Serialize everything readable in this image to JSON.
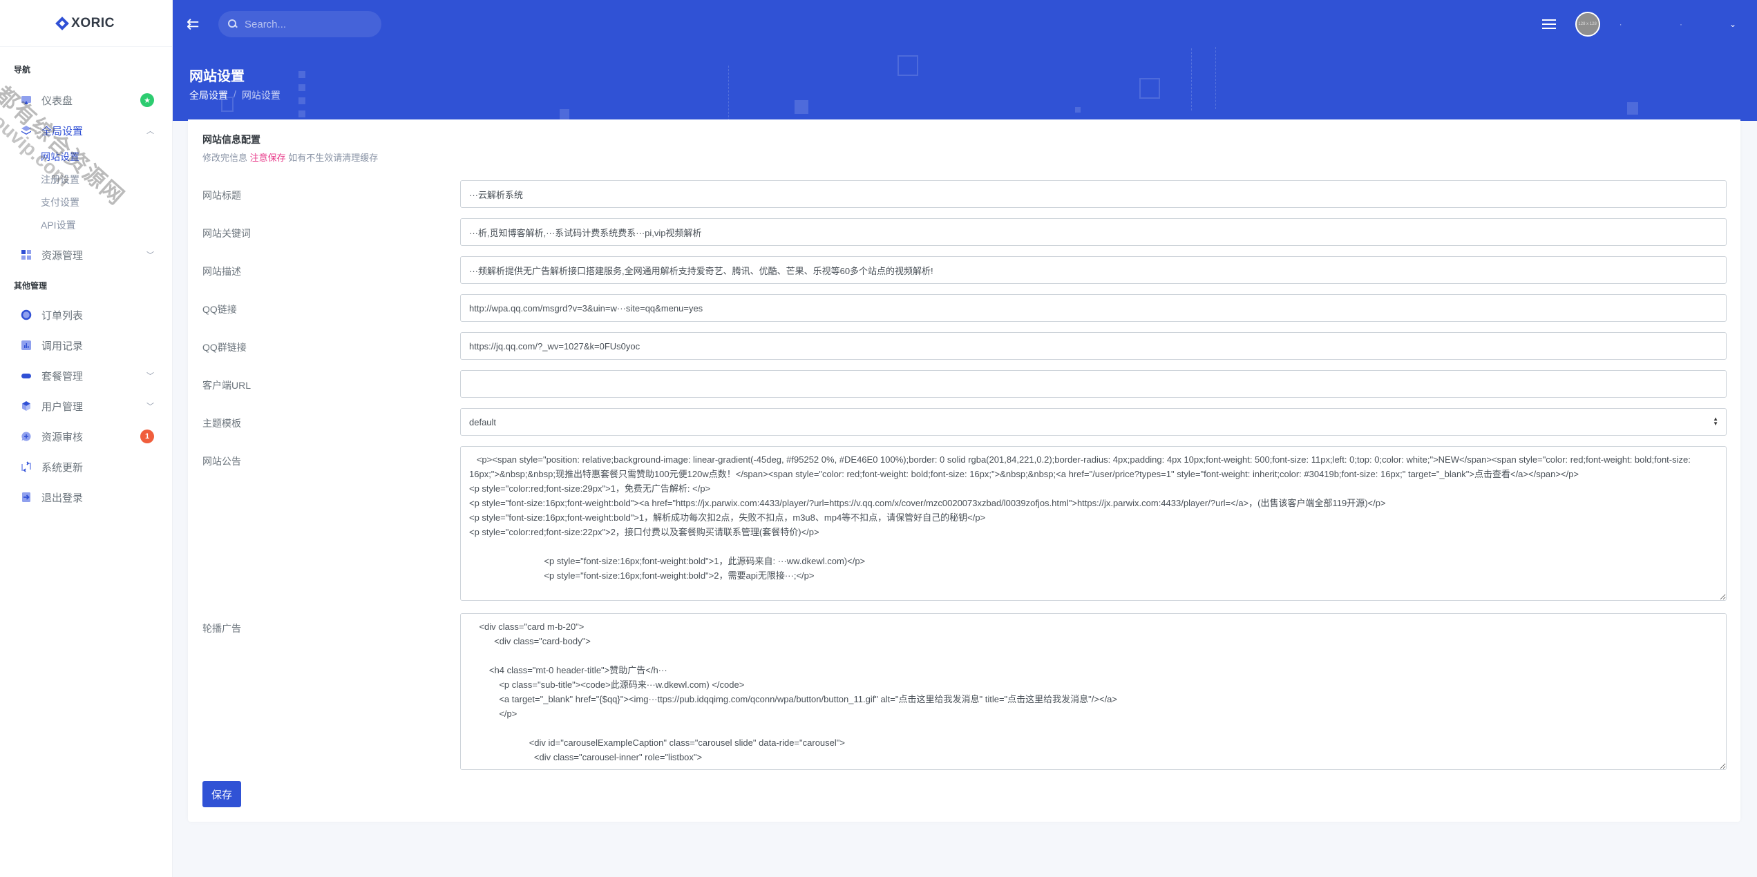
{
  "brand": {
    "name": "XORIC",
    "accent_color": "#3052d5"
  },
  "watermark": {
    "line1": "全都有综合资源网",
    "line2": "douyouvip.com"
  },
  "sidebar": {
    "section1_title": "导航",
    "section2_title": "其他管理",
    "items": [
      {
        "label": "仪表盘",
        "icon": "monitor-icon",
        "badge": "★",
        "badge_color": "#2dcc70"
      },
      {
        "label": "全局设置",
        "icon": "layers-icon",
        "expanded": true,
        "active": true
      },
      {
        "label": "资源管理",
        "icon": "grid-icon",
        "expandable": true
      }
    ],
    "submenu": [
      {
        "label": "网站设置",
        "active": true
      },
      {
        "label": "注册设置"
      },
      {
        "label": "支付设置"
      },
      {
        "label": "API设置"
      }
    ],
    "other_items": [
      {
        "label": "订单列表",
        "icon": "circle-icon"
      },
      {
        "label": "调用记录",
        "icon": "bar-chart-icon"
      },
      {
        "label": "套餐管理",
        "icon": "pill-icon",
        "expandable": true
      },
      {
        "label": "用户管理",
        "icon": "cube-icon",
        "expandable": true
      },
      {
        "label": "资源审核",
        "icon": "chat-plus-icon",
        "badge": "1",
        "badge_color": "#f05e3c"
      },
      {
        "label": "系统更新",
        "icon": "refresh-icon"
      },
      {
        "label": "退出登录",
        "icon": "logout-icon"
      }
    ]
  },
  "topbar": {
    "search_placeholder": "Search...",
    "avatar_text": "128 x 128",
    "user_name": "· ·"
  },
  "page": {
    "title": "网站设置",
    "breadcrumb": [
      "全局设置",
      "网站设置"
    ]
  },
  "card": {
    "title": "网站信息配置",
    "subtitle_before": "修改完信息 ",
    "subtitle_warn": "注意保存",
    "subtitle_after": " 如有不生效请清理缓存",
    "save_label": "保存"
  },
  "form": {
    "site_title": {
      "label": "网站标题",
      "value": "···云解析系统"
    },
    "keywords": {
      "label": "网站关键词",
      "value": "···析,觅知博客解析,···系试码计费系统费系···pi,vip视频解析"
    },
    "description": {
      "label": "网站描述",
      "value": "···频解析提供无广告解析接口搭建服务,全网通用解析支持爱奇艺、腾讯、优酷、芒果、乐视等60多个站点的视频解析!"
    },
    "qq_link": {
      "label": "QQ链接",
      "value": "http://wpa.qq.com/msgrd?v=3&uin=w···site=qq&menu=yes"
    },
    "qq_group_link": {
      "label": "QQ群链接",
      "value": "https://jq.qq.com/?_wv=1027&k=0FUs0yoc"
    },
    "client_url": {
      "label": "客户端URL",
      "value": ""
    },
    "theme": {
      "label": "主题模板",
      "value": "default"
    },
    "notice": {
      "label": "网站公告",
      "value": "   <p><span style=\"position: relative;background-image: linear-gradient(-45deg, #f95252 0%, #DE46E0 100%);border: 0 solid rgba(201,84,221,0.2);border-radius: 4px;padding: 4px 10px;font-weight: 500;font-size: 11px;left: 0;top: 0;color: white;\">NEW</span><span style=\"color: red;font-weight: bold;font-size: 16px;\">&nbsp;&nbsp;现推出特惠套餐只需赞助100元便120w点数！</span><span style=\"color: red;font-weight: bold;font-size: 16px;\">&nbsp;&nbsp;<a href=\"/user/price?types=1\" style=\"font-weight: inherit;color: #30419b;font-size: 16px;\" target=\"_blank\">点击查看</a></span></p>\n<p style=\"color:red;font-size:29px\">1，免费无广告解析: </p>\n<p style=\"font-size:16px;font-weight:bold\"><a href=\"https://jx.parwix.com:4433/player/?url=https://v.qq.com/x/cover/mzc0020073xzbad/l0039zofjos.html\">https://jx.parwix.com:4433/player/?url=</a>，(出售该客户端全部119开源)</p>\n<p style=\"font-size:16px;font-weight:bold\">1，解析成功每次扣2点，失败不扣点，m3u8、mp4等不扣点，请保管好自己的秘钥</p>\n<p style=\"color:red;font-size:22px\">2，接口付费以及套餐购买请联系管理(套餐特价)</p>\n\n                              <p style=\"font-size:16px;font-weight:bold\">1，此源码来自: ···ww.dkewl.com)</p>\n                              <p style=\"font-size:16px;font-weight:bold\">2，需要api无限接···;</p>"
    },
    "carousel": {
      "label": "轮播广告",
      "value": "    <div class=\"card m-b-20\">\n          <div class=\"card-body\">\n\n        <h4 class=\"mt-0 header-title\">赞助广告</h···\n            <p class=\"sub-title\"><code>此源码来···w.dkewl.com) </code>\n            <a target=\"_blank\" href=\"{$qq}\"><img···ttps://pub.idqqimg.com/qconn/wpa/button/button_11.gif\" alt=\"点击这里给我发消息\" title=\"点击这里给我发消息\"/></a>\n            </p>\n\n                        <div id=\"carouselExampleCaption\" class=\"carousel slide\" data-ride=\"carousel\">\n                          <div class=\"carousel-inner\" role=\"listbox\">"
    }
  }
}
